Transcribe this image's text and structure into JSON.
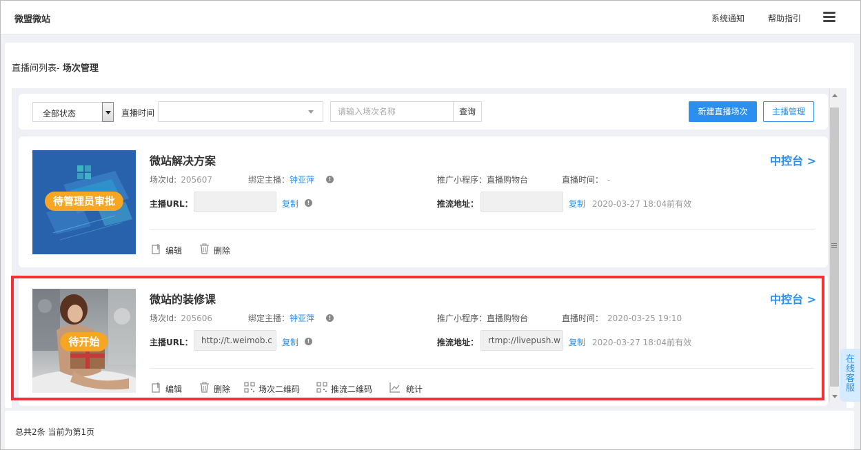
{
  "header": {
    "brand": "微盟微站",
    "notify": "系统通知",
    "help": "帮助指引"
  },
  "breadcrumb": {
    "prefix": "直播间列表-",
    "current": "场次管理"
  },
  "filters": {
    "status_value": "全部状态",
    "time_label": "直播时间",
    "search_placeholder": "请输入场次名称",
    "search_button": "查询",
    "new_button": "新建直播场次",
    "host_button": "主播管理"
  },
  "sessions": [
    {
      "badge": "待管理员审批",
      "title": "微站解决方案",
      "console": "中控台 >",
      "id_label": "场次Id:",
      "id": "205607",
      "host_label": "绑定主播：",
      "host": "钟亚萍",
      "mini_program": "推广小程序：直播购物台",
      "time_label": "直播时间：",
      "time": "-",
      "host_url_label": "主播URL：",
      "host_url": "",
      "copy_label": "复制",
      "push_label": "推流地址：",
      "push_url": "",
      "push_copy": "复制",
      "valid": "2020-03-27 18:04前有效",
      "actions": [
        "编辑",
        "删除"
      ]
    },
    {
      "badge": "待开始",
      "title": "微站的装修课",
      "console": "中控台 >",
      "id_label": "场次Id:",
      "id": "205606",
      "host_label": "绑定主播：",
      "host": "钟亚萍",
      "mini_program": "推广小程序：直播购物台",
      "time_label": "直播时间：",
      "time": "2020-03-25 19:10",
      "host_url_label": "主播URL：",
      "host_url": "http://t.weimob.c",
      "copy_label": "复制",
      "push_label": "推流地址：",
      "push_url": "rtmp://livepush.w",
      "push_copy": "复制",
      "valid": "2020-03-27 18:04前有效",
      "actions": [
        "编辑",
        "删除",
        "场次二维码",
        "推流二维码",
        "统计"
      ]
    }
  ],
  "online_service": [
    "在",
    "线",
    "客",
    "服"
  ],
  "footer": {
    "summary": "总共2条 当前为第1页"
  },
  "colors": {
    "accent": "#2b8ff0",
    "badge": "#f6a623",
    "highlight": "#f03237"
  }
}
